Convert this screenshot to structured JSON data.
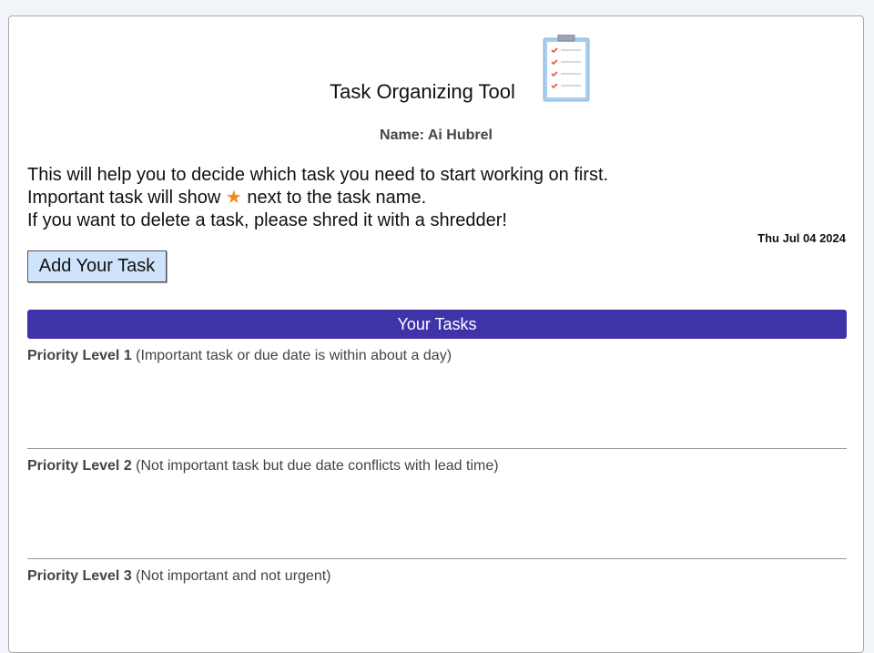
{
  "app": {
    "title": "Task Organizing Tool",
    "clipboard_icon": "clipboard-checklist-icon"
  },
  "user": {
    "label": "Name:",
    "name": "Ai Hubrel"
  },
  "intro": {
    "line1": "This will help you to decide which task you need to start working on first.",
    "line2_prefix": "Important task will show ",
    "line2_star": "★",
    "line2_suffix": " next to the task name.",
    "line3": "If you want to delete a task, please shred it with a shredder!"
  },
  "date": "Thu Jul 04 2024",
  "add_button_label": "Add Your Task",
  "tasks_header": "Your Tasks",
  "priorities": [
    {
      "level": "Priority Level 1",
      "description": " (Important task or due date is within about a day)"
    },
    {
      "level": "Priority Level 2",
      "description": " (Not important task but due date conflicts with lead time)"
    },
    {
      "level": "Priority Level 3",
      "description": " (Not important and not urgent)"
    }
  ],
  "colors": {
    "header_bg": "#3f33a8",
    "button_bg": "#cfe4fb",
    "star": "#f08a24",
    "page_bg": "#f1f4f8"
  }
}
